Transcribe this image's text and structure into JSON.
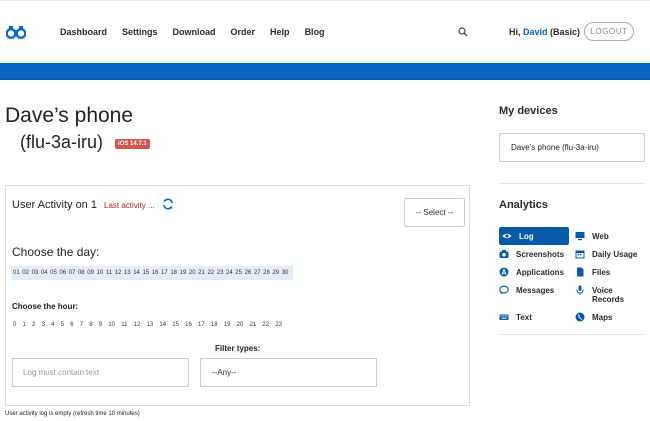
{
  "header": {
    "nav": [
      "Dashboard",
      "Settings",
      "Download",
      "Order",
      "Help",
      "Blog"
    ],
    "greeting_prefix": "Hi, ",
    "user_name": "David",
    "plan": " (Basic)",
    "logout_label": "LOGOUT"
  },
  "device": {
    "name": "Dave’s phone",
    "id": "(flu-3a-iru)",
    "os_badge": "iOS 14.7.1"
  },
  "activity": {
    "title": "User Activity on 1",
    "last_activity": "Last activity ...",
    "select_label": "-- Select --",
    "choose_day": "Choose the day:",
    "days": [
      "01",
      "02",
      "03",
      "04",
      "05",
      "06",
      "07",
      "08",
      "09",
      "10",
      "11",
      "12",
      "13",
      "14",
      "15",
      "16",
      "17",
      "18",
      "19",
      "20",
      "21",
      "22",
      "23",
      "24",
      "25",
      "26",
      "27",
      "28",
      "29",
      "30"
    ],
    "choose_hour": "Choose the hour:",
    "hours": [
      "0",
      "1",
      "2",
      "3",
      "4",
      "5",
      "6",
      "7",
      "8",
      "9",
      "10",
      "11",
      "12",
      "13",
      "14",
      "15",
      "16",
      "17",
      "18",
      "19",
      "20",
      "21",
      "22",
      "23"
    ],
    "filter_label": "Filter types:",
    "log_placeholder": "Log must contain text",
    "filter_value": "--Any--",
    "empty_note": "User activity log is empty (refresh time 10 minutes)"
  },
  "sidebar": {
    "my_devices": "My devices",
    "device_item": "Dave’s phone (flu-3a-iru)",
    "analytics": "Analytics",
    "menu": [
      {
        "label": "Log",
        "icon": "eye-icon",
        "active": true
      },
      {
        "label": "Web",
        "icon": "monitor-icon",
        "active": false
      },
      {
        "label": "Screenshots",
        "icon": "camera-icon",
        "active": false
      },
      {
        "label": "Daily Usage",
        "icon": "calendar-icon",
        "active": false
      },
      {
        "label": "Applications",
        "icon": "app-store-icon",
        "active": false
      },
      {
        "label": "Files",
        "icon": "file-icon",
        "active": false
      },
      {
        "label": "Messages",
        "icon": "chat-bubble-icon",
        "active": false
      },
      {
        "label": "Voice Records",
        "icon": "microphone-icon",
        "active": false
      },
      {
        "label": "Text",
        "icon": "keyboard-icon",
        "active": false
      },
      {
        "label": "Maps",
        "icon": "globe-icon",
        "active": false
      }
    ]
  },
  "colors": {
    "brand_blue": "#0a68c4",
    "active_menu": "#0a5aaa",
    "badge_red": "#d9534f",
    "last_activity_red": "#a82323"
  }
}
